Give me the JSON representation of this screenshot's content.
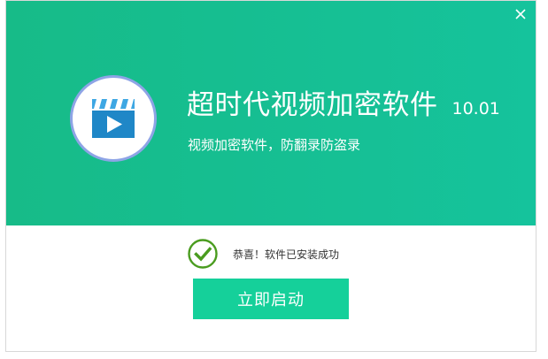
{
  "window": {
    "close_icon": "close-icon"
  },
  "banner": {
    "logo_icon": "video-clapperboard-icon",
    "app_name": "超时代视频加密软件",
    "version": "10.01",
    "subtitle": "视频加密软件，防翻录防盗录"
  },
  "status": {
    "icon": "check-circle-icon",
    "message": "恭喜！软件已安装成功"
  },
  "actions": {
    "launch_label": "立即启动"
  },
  "colors": {
    "banner": "#16bf93",
    "button": "#15d09a",
    "check": "#4a9c1f",
    "logo_ring": "#8ea4e6",
    "logo_blue": "#1f87c7"
  }
}
